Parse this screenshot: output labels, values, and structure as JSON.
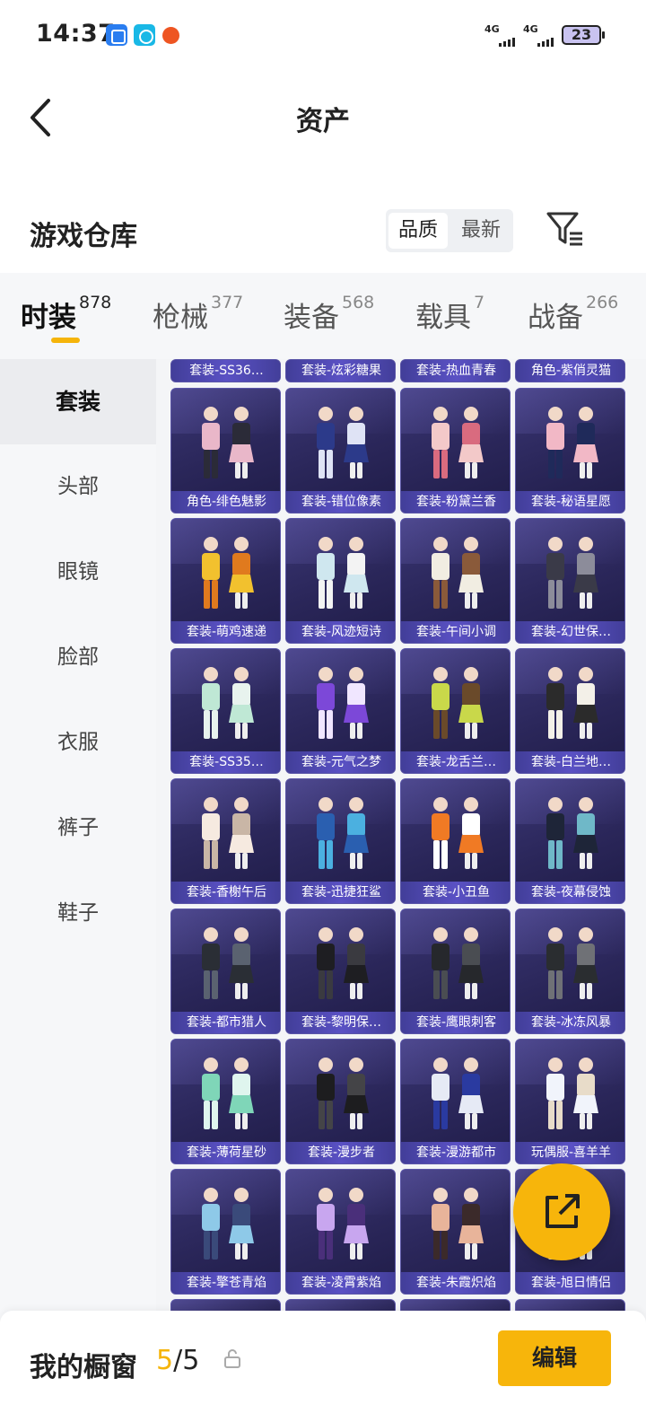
{
  "status_bar": {
    "time": "14:37",
    "network1": "4G",
    "network2": "4G",
    "battery": "23"
  },
  "header": {
    "title": "资产"
  },
  "section": {
    "title": "游戏仓库",
    "sort_quality": "品质",
    "sort_latest": "最新"
  },
  "tabs": [
    {
      "label": "时装",
      "count": "878"
    },
    {
      "label": "枪械",
      "count": "377"
    },
    {
      "label": "装备",
      "count": "568"
    },
    {
      "label": "载具",
      "count": "7"
    },
    {
      "label": "战备",
      "count": "266"
    }
  ],
  "categories": [
    "套装",
    "头部",
    "眼镜",
    "脸部",
    "衣服",
    "裤子",
    "鞋子"
  ],
  "items_partial_top": [
    "套装-SS36…",
    "套装-炫彩糖果",
    "套装-热血青春",
    "角色-紫俏灵猫"
  ],
  "items": [
    "角色-绯色魅影",
    "套装-错位像素",
    "套装-粉黛兰香",
    "套装-秘语星愿",
    "套装-萌鸡速递",
    "套装-风迹短诗",
    "套装-午间小调",
    "套装-幻世保…",
    "套装-SS35…",
    "套装-元气之梦",
    "套装-龙舌兰…",
    "套装-白兰地…",
    "套装-香榭午后",
    "套装-迅捷狂鲨",
    "套装-小丑鱼",
    "套装-夜幕侵蚀",
    "套装-都市猎人",
    "套装-黎明保…",
    "套装-鹰眼刺客",
    "套装-冰冻风暴",
    "套装-薄荷星砂",
    "套装-漫步者",
    "套装-漫游都市",
    "玩偶服-喜羊羊",
    "套装-擎苍青焰",
    "套装-凌霄紫焰",
    "套装-朱霞炽焰",
    "套装-旭日情侣"
  ],
  "item_colors": [
    [
      "#e9b7c9",
      "#2b2b38"
    ],
    [
      "#2c3a8a",
      "#dfe3f5"
    ],
    [
      "#f3c9c9",
      "#d96b7f"
    ],
    [
      "#f2b8c6",
      "#1f2a5a"
    ],
    [
      "#f2c12e",
      "#e07a1e"
    ],
    [
      "#cfe7ef",
      "#f3f3f3"
    ],
    [
      "#f1ede2",
      "#8a5a3a"
    ],
    [
      "#3a3a48",
      "#8c8c9a"
    ],
    [
      "#bfe8d5",
      "#e8f3ee"
    ],
    [
      "#7c48d8",
      "#f0e6ff"
    ],
    [
      "#c9d84a",
      "#6a4a2a"
    ],
    [
      "#2b2b2b",
      "#f3f0e8"
    ],
    [
      "#f6eae0",
      "#c9b6a6"
    ],
    [
      "#2a5fb0",
      "#4bb0e0"
    ],
    [
      "#f07a24",
      "#ffffff"
    ],
    [
      "#1e2538",
      "#6fb8c8"
    ],
    [
      "#2a2e35",
      "#5a6270"
    ],
    [
      "#1e1e22",
      "#3a3a40"
    ],
    [
      "#26282c",
      "#4a4d52"
    ],
    [
      "#2a2d30",
      "#6f7176"
    ],
    [
      "#7fd6b8",
      "#dff5ee"
    ],
    [
      "#1d1d1f",
      "#444447"
    ],
    [
      "#e6eaf5",
      "#2a3aa0"
    ],
    [
      "#f1f4fb",
      "#e8dcc9"
    ],
    [
      "#8ec9e8",
      "#3a4a7a"
    ],
    [
      "#c8a6ef",
      "#4a2f7a"
    ],
    [
      "#e8b49a",
      "#3b2a2a"
    ],
    [
      "#f4b86a",
      "#ffffff"
    ]
  ],
  "bottom_bar": {
    "label": "我的橱窗",
    "count_current": "5",
    "count_sep": "/",
    "count_total": "5",
    "edit_label": "编辑"
  },
  "colors": {
    "accent": "#f7b50b",
    "card_bg": "#2a2659",
    "card_label": "#5a51c4"
  },
  "icons": {
    "back": "back-arrow-icon",
    "filter": "filter-icon",
    "share": "share-icon",
    "lock": "lock-icon"
  }
}
